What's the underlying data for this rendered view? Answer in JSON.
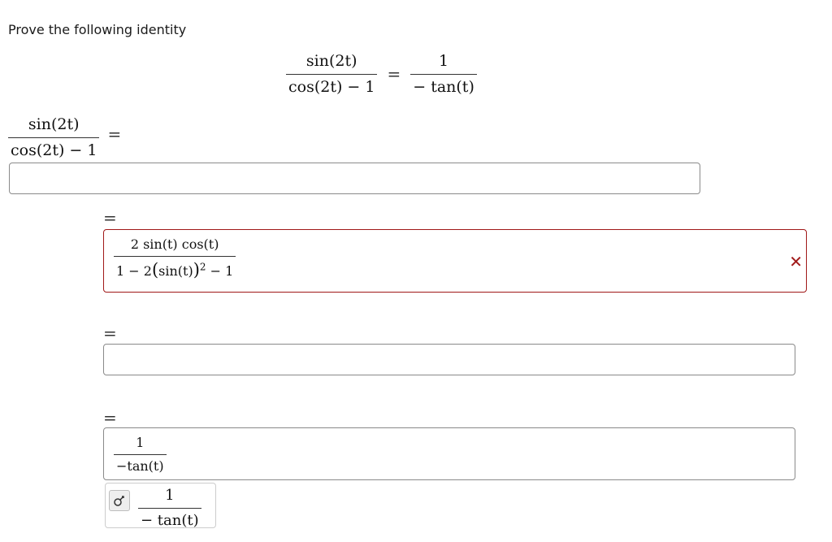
{
  "prompt": {
    "text": "Prove the following identity"
  },
  "identity": {
    "left_num": "sin(2t)",
    "left_den": "cos(2t) − 1",
    "equals": "=",
    "right_num": "1",
    "right_den": "− tan(t)"
  },
  "start_expression": {
    "num": "sin(2t)",
    "den": "cos(2t) − 1",
    "equals": "="
  },
  "steps": [
    {
      "equals": "=",
      "value": ""
    },
    {
      "equals": "=",
      "num": "2 sin(t) cos(t)",
      "den_prefix": "1 − 2",
      "den_inner": "sin(t)",
      "den_exp": "2",
      "den_suffix": "− 1",
      "status": "incorrect",
      "status_mark": "✕"
    },
    {
      "equals": "=",
      "value": ""
    },
    {
      "equals": "=",
      "num": "1",
      "den": "−tan(t)"
    }
  ],
  "preview": {
    "num": "1",
    "den": "− tan(t)"
  },
  "icons": {
    "status_incorrect": "close-icon",
    "preview_toggle": "formula-icon"
  },
  "colors": {
    "error": "#a01818",
    "border": "#8a8a8a"
  }
}
